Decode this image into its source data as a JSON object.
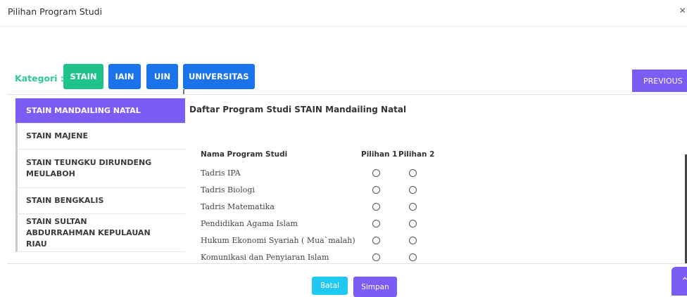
{
  "modal": {
    "title": "Pilihan Program Studi",
    "close_symbol": "×"
  },
  "kategori": {
    "label": "Kategori :",
    "buttons": [
      "STAIN",
      "IAIN",
      "UIN",
      "UNIVERSITAS"
    ],
    "active": "STAIN"
  },
  "previous_label": "PREVIOUS",
  "sidebar": {
    "items": [
      {
        "label": "STAIN MANDAILING NATAL",
        "active": true
      },
      {
        "label": "STAIN MAJENE",
        "active": false
      },
      {
        "label": "STAIN TEUNGKU DIRUNDENG MEULABOH",
        "active": false
      },
      {
        "label": "STAIN BENGKALIS",
        "active": false
      },
      {
        "label": "STAIN SULTAN ABDURRAHMAN KEPULAUAN RIAU",
        "active": false
      }
    ]
  },
  "main": {
    "title": "Daftar Program Studi STAIN Mandailing Natal",
    "headers": {
      "name": "Nama Program Studi",
      "pilihan1": "Pilihan 1",
      "pilihan2": "Pilihan 2"
    },
    "rows": [
      "Tadris IPA",
      "Tadris Biologi",
      "Tadris Matematika",
      "Pendidikan Agama Islam",
      "Hukum Ekonomi Syariah ( Mua`malah)",
      "Komunikasi dan Penyiaran Islam"
    ]
  },
  "footer": {
    "batal": "Batal",
    "simpan": "Simpan"
  },
  "colors": {
    "accent_purple": "#7b5cf5",
    "green": "#1fc28c",
    "blue": "#1a73e8",
    "cyan": "#1ec8f0"
  },
  "icons": {
    "close": "close-icon",
    "scroll_top": "chevron-up-icon"
  }
}
